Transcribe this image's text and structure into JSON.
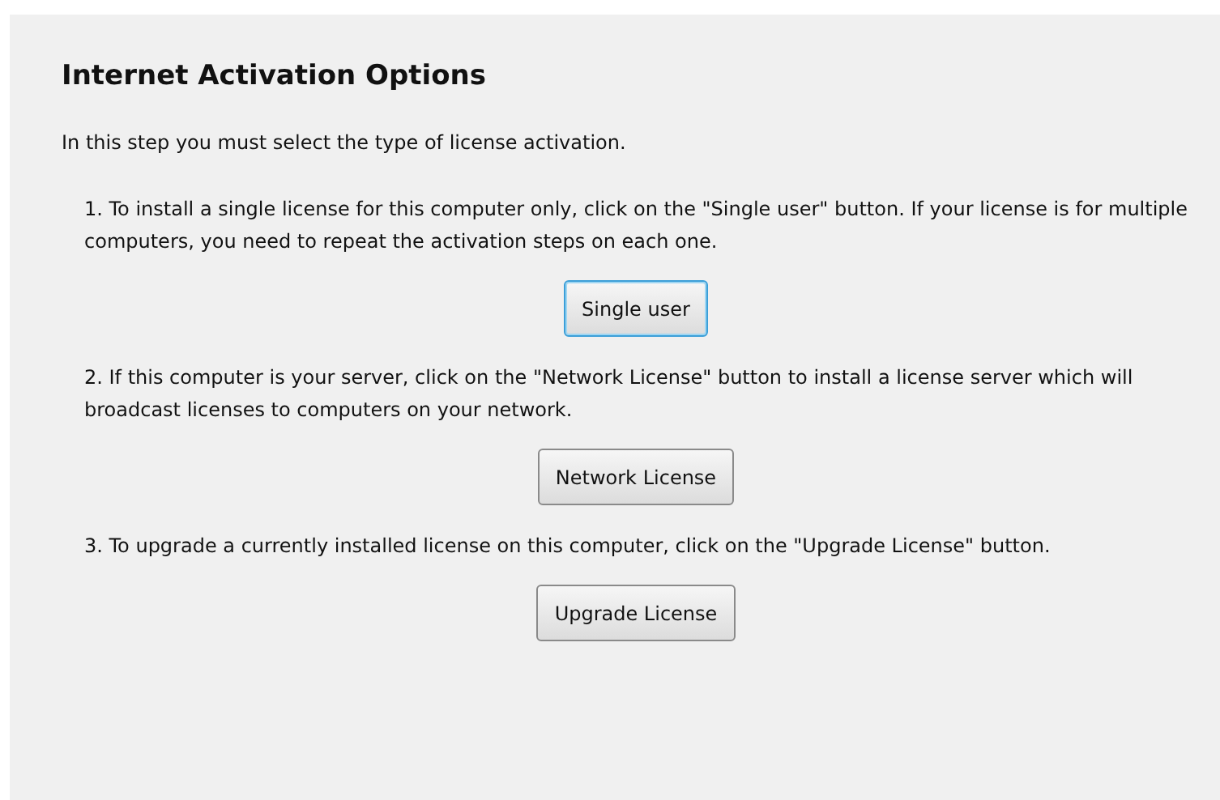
{
  "title": "Internet Activation Options",
  "intro": "In this step you must select the type of license activation.",
  "options": [
    {
      "description": "1. To install a single license for this computer only, click on the \"Single user\" button. If your license is for multiple computers, you need to repeat the activation steps on each one.",
      "button": "Single user",
      "focused": true
    },
    {
      "description": "2. If this computer is your server, click on the \"Network License\" button to install a license server which will broadcast licenses to computers on your network.",
      "button": "Network License",
      "focused": false
    },
    {
      "description": "3. To upgrade a currently installed license on this computer, click on the \"Upgrade License\" button.",
      "button": "Upgrade License",
      "focused": false
    }
  ]
}
